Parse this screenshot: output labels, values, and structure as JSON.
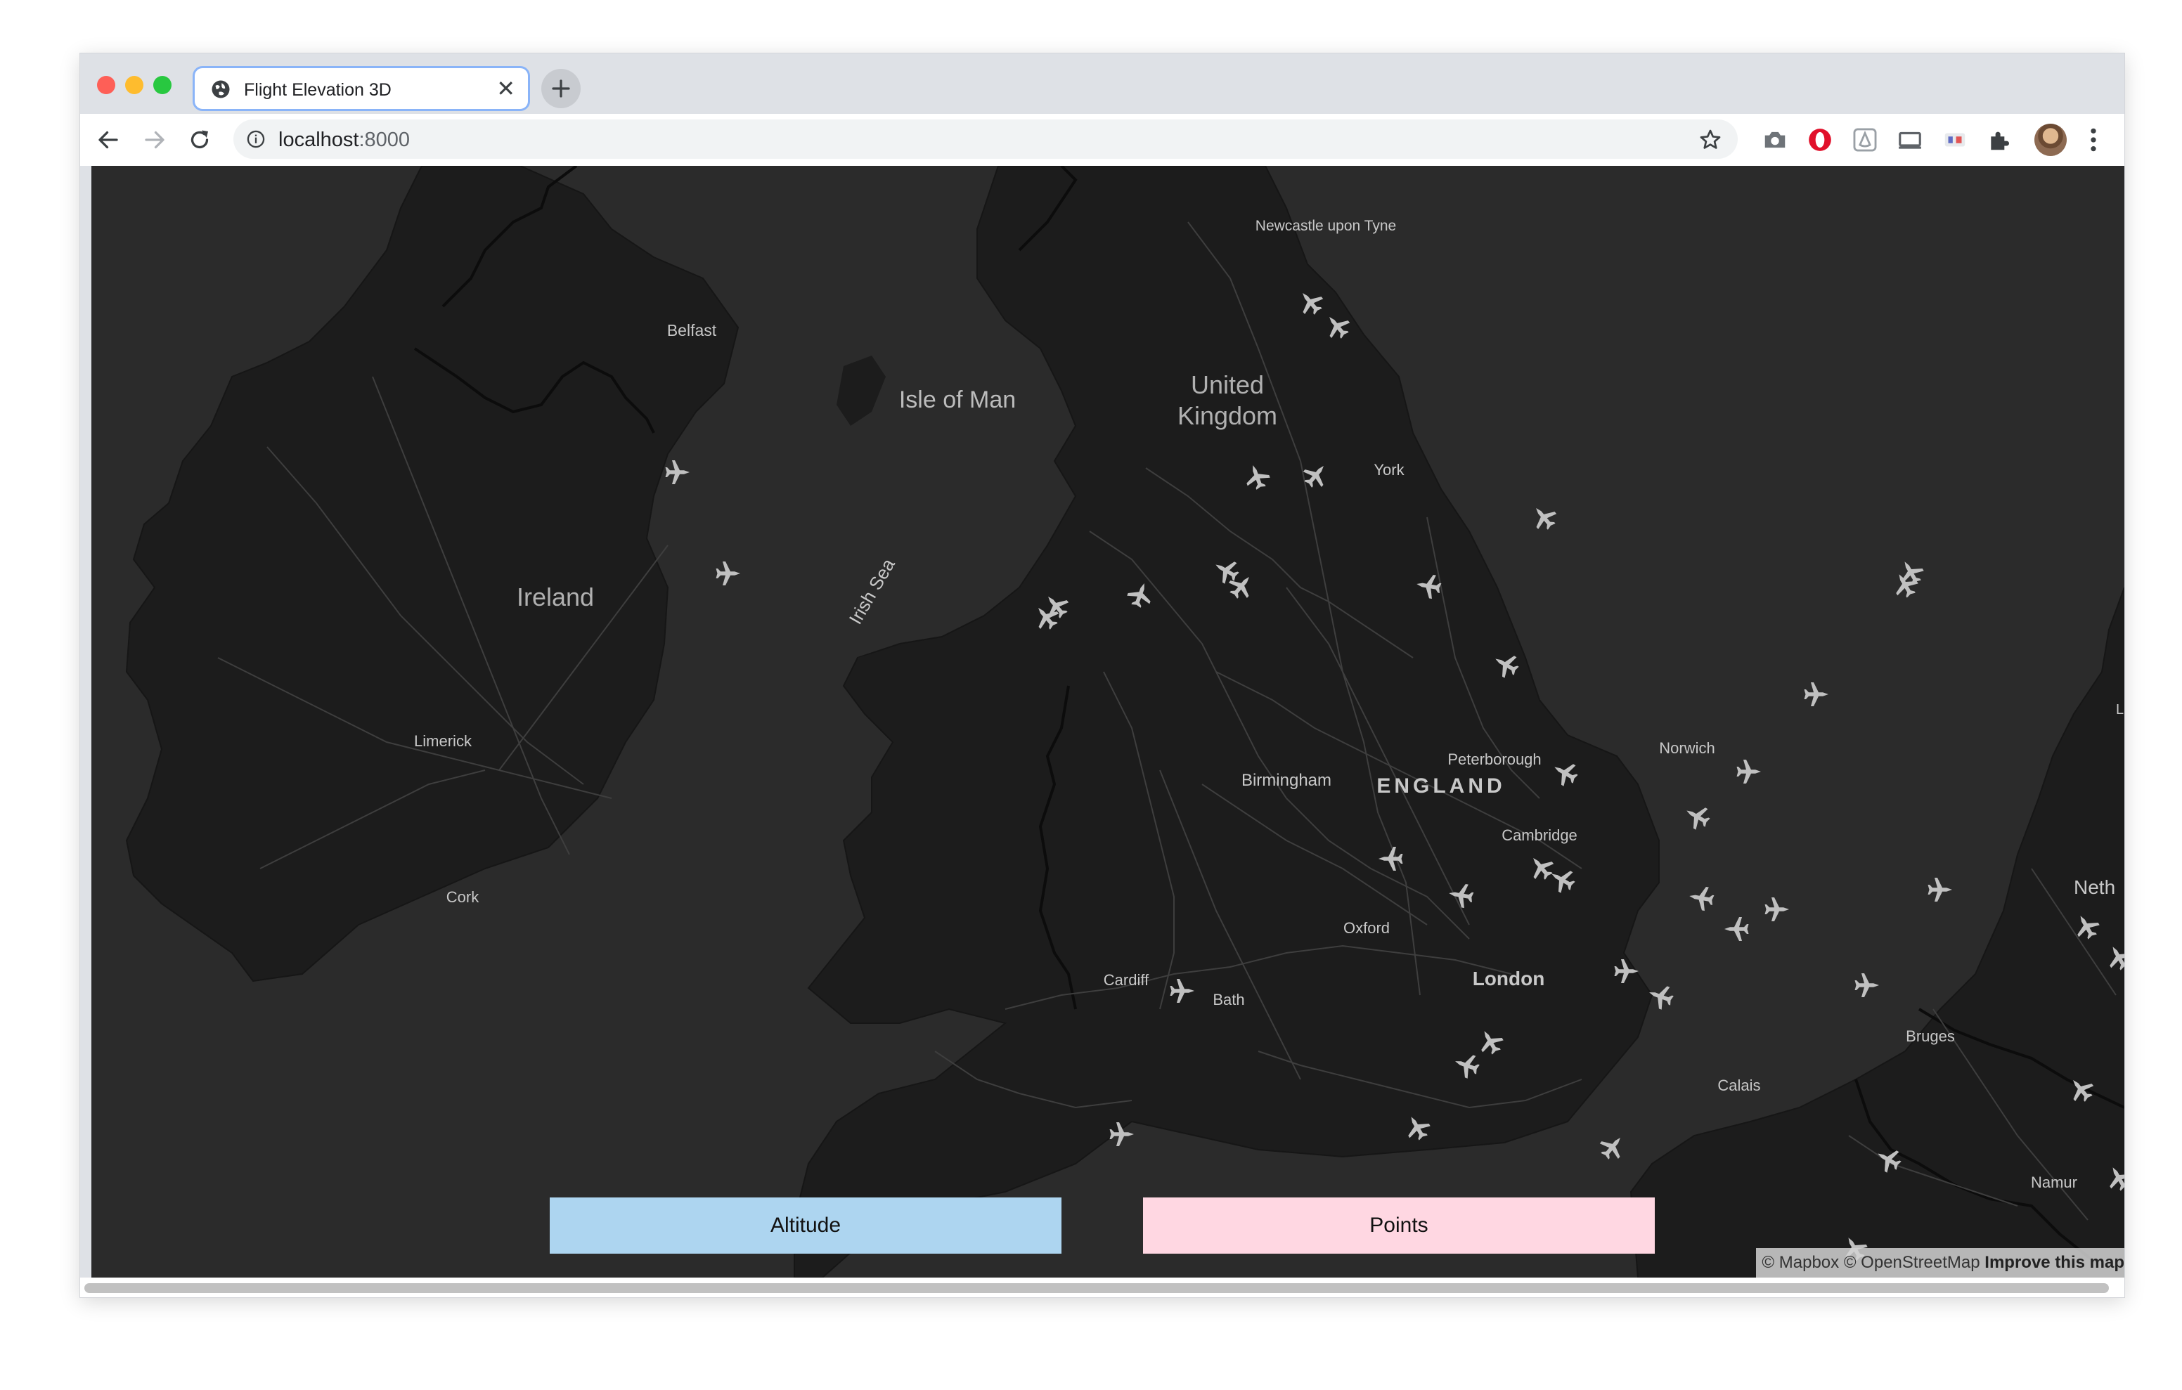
{
  "browser": {
    "tab_title": "Flight Elevation 3D",
    "tab_close": "✕",
    "url_host": "localhost",
    "url_port": ":8000"
  },
  "map": {
    "places": {
      "newcastle": "Newcastle upon Tyne",
      "belfast": "Belfast",
      "isle_of_man": "Isle of Man",
      "uk_line1": "United",
      "uk_line2": "Kingdom",
      "york": "York",
      "ireland": "Ireland",
      "irish_sea": "Irish Sea",
      "limerick": "Limerick",
      "cork": "Cork",
      "norwich": "Norwich",
      "peterborough": "Peterborough",
      "birmingham": "Birmingham",
      "england": "ENGLAND",
      "cambridge": "Cambridge",
      "oxford": "Oxford",
      "london": "London",
      "cardiff": "Cardiff",
      "bath": "Bath",
      "bruges": "Bruges",
      "calais": "Calais",
      "namur": "Namur",
      "neth": "Neth",
      "l_edge": "L"
    },
    "plane_icon": "airplane-icon",
    "colors": {
      "land": "#1c1c1c",
      "water": "#2b2b2b",
      "roads": "#3e3e3e",
      "planes": "#c0c0c0"
    }
  },
  "controls": {
    "altitude_label": "Altitude",
    "points_label": "Points",
    "altitude_color": "#add5f0",
    "points_color": "#ffd7e2"
  },
  "attribution": {
    "mapbox": "© Mapbox",
    "osm": "© OpenStreetMap",
    "improve": "Improve this map"
  }
}
